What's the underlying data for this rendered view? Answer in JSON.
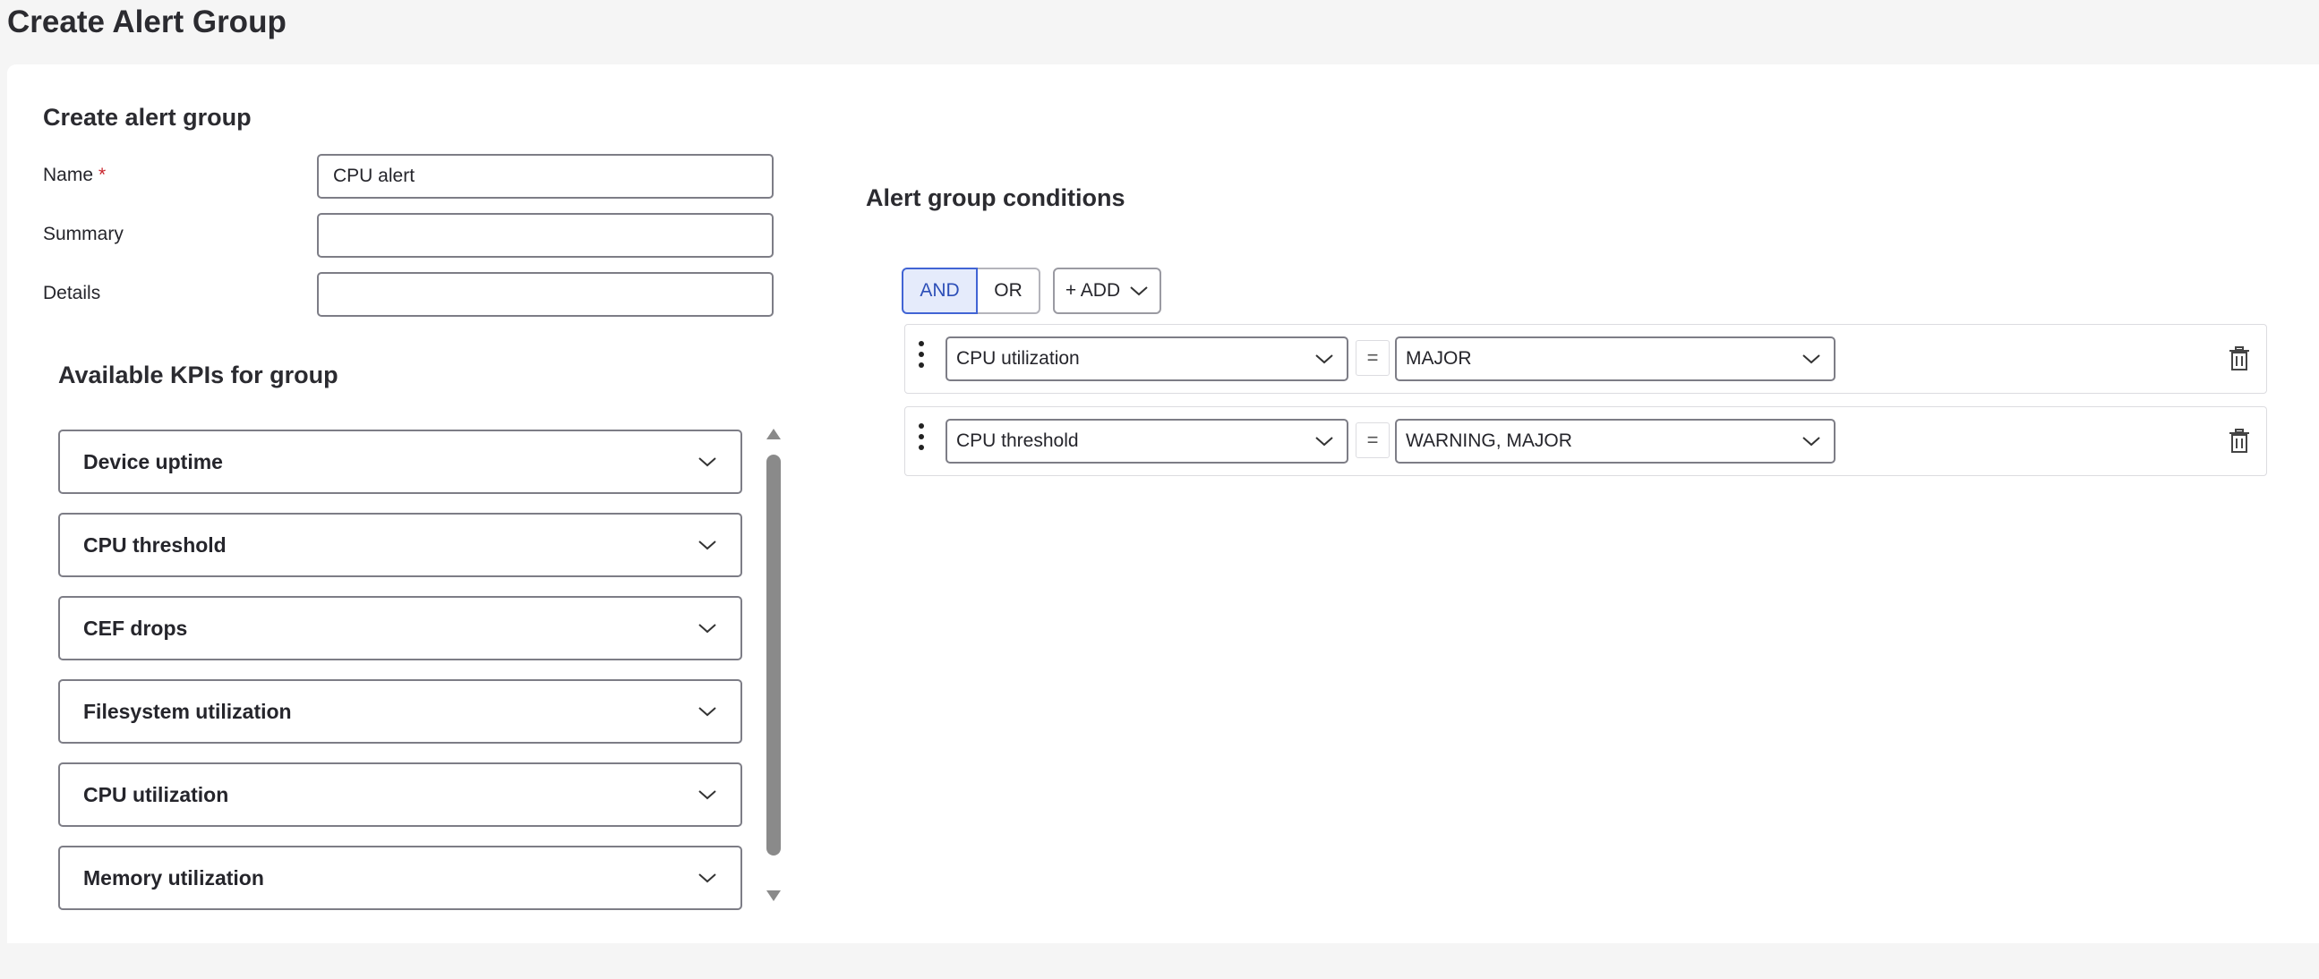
{
  "page": {
    "title": "Create Alert Group"
  },
  "form": {
    "section_title": "Create alert group",
    "name_label": "Name",
    "required_marker": "*",
    "name_value": "CPU alert",
    "summary_label": "Summary",
    "summary_value": "",
    "details_label": "Details",
    "details_value": ""
  },
  "kpis": {
    "title": "Available KPIs for group",
    "items": [
      {
        "label": "Device uptime"
      },
      {
        "label": "CPU threshold"
      },
      {
        "label": "CEF drops"
      },
      {
        "label": "Filesystem utilization"
      },
      {
        "label": "CPU utilization"
      },
      {
        "label": "Memory utilization"
      }
    ]
  },
  "conditions": {
    "title": "Alert group conditions",
    "and_label": "AND",
    "or_label": "OR",
    "selected_logic": "AND",
    "add_label": "+ ADD",
    "rows": [
      {
        "kpi": "CPU utilization",
        "operator": "=",
        "value": "MAJOR"
      },
      {
        "kpi": "CPU threshold",
        "operator": "=",
        "value": "WARNING, MAJOR"
      }
    ]
  },
  "colors": {
    "accent": "#4164d4",
    "accent_bg": "#e5ebfb",
    "required": "#c9252d",
    "border": "#7d7d86"
  },
  "icons": {
    "expand": "chevron-down-icon",
    "delete": "trash-icon",
    "drag": "drag-handle-icon"
  }
}
